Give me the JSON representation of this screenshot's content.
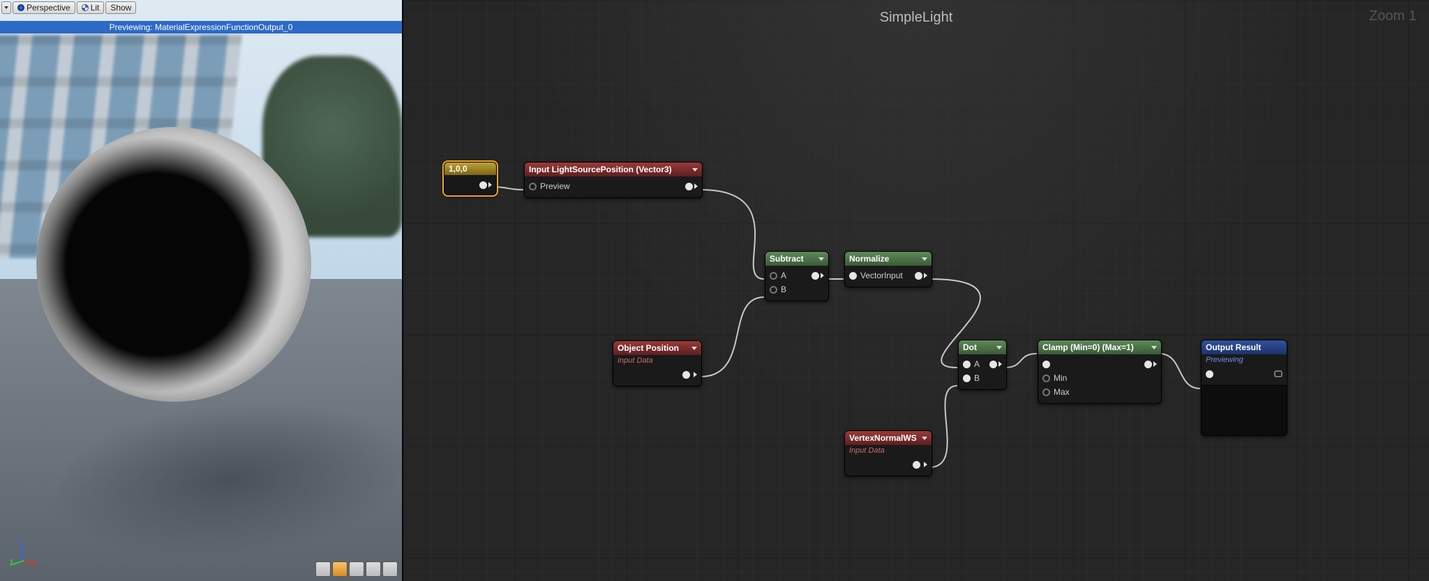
{
  "viewport": {
    "toolbar": {
      "perspective": "Perspective",
      "lit": "Lit",
      "show": "Show"
    },
    "preview_banner": "Previewing: MaterialExpressionFunctionOutput_0",
    "axis": {
      "x": "x",
      "y": "y",
      "z": "z"
    }
  },
  "graph": {
    "title": "SimpleLight",
    "zoom": "Zoom 1",
    "nodes": {
      "const100": {
        "label": "1,0,0"
      },
      "inputLight": {
        "title": "Input LightSourcePosition (Vector3)",
        "row": "Preview"
      },
      "objectPos": {
        "title": "Object Position",
        "sub": "Input Data"
      },
      "subtract": {
        "title": "Subtract",
        "a": "A",
        "b": "B"
      },
      "normalize": {
        "title": "Normalize",
        "row": "VectorInput"
      },
      "vertexNormal": {
        "title": "VertexNormalWS",
        "sub": "Input Data"
      },
      "dot": {
        "title": "Dot",
        "a": "A",
        "b": "B"
      },
      "clamp": {
        "title": "Clamp (Min=0) (Max=1)",
        "min": "Min",
        "max": "Max"
      },
      "output": {
        "title": "Output Result",
        "sub": "Previewing"
      }
    }
  }
}
